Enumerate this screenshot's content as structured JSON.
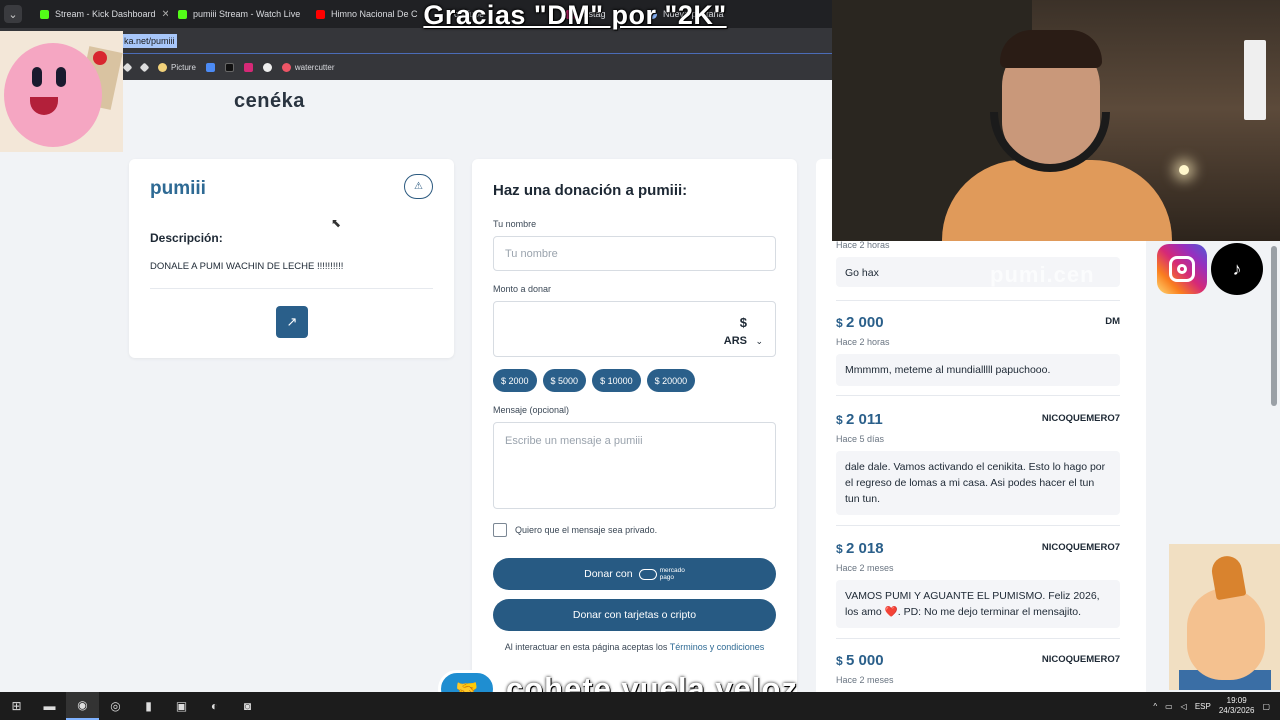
{
  "browser": {
    "tabs": [
      {
        "label": "Stream - Kick Dashboard",
        "color": "#53fc18"
      },
      {
        "label": "pumiii Stream - Watch Live",
        "color": "#53fc18"
      },
      {
        "label": "Himno Nacional De C",
        "color": "#ff0000"
      },
      {
        "label": "ouTube",
        "color": "#ff0000"
      },
      {
        "label": "Instag",
        "color": "#d62976"
      },
      {
        "label": "Nueva pestaña",
        "color": "#8ab4f8"
      }
    ],
    "address": "ka.net/pumiii",
    "bookmarks": [
      {
        "label": "",
        "icon": "bookmark-diamond-icon",
        "color": "#ddd"
      },
      {
        "label": "",
        "icon": "bookmark-diamond-icon",
        "color": "#ddd"
      },
      {
        "label": "Picture",
        "icon": "picture-icon",
        "color": "#f2d27a"
      },
      {
        "label": "",
        "icon": "bookmark-square-icon",
        "color": "#4c8bf5"
      },
      {
        "label": "",
        "icon": "tiktok-icon",
        "color": "#111"
      },
      {
        "label": "",
        "icon": "instagram-icon",
        "color": "#d62976"
      },
      {
        "label": "",
        "icon": "circle-icon",
        "color": "#eee"
      },
      {
        "label": "watercutter",
        "icon": "watercutter-icon",
        "color": "#e56"
      }
    ]
  },
  "overlay": {
    "title": "Gracias \"DM\" por \"2K\"",
    "ghost_text": "pumi.cen",
    "bottom_brand": "cohete.vuela.veloz"
  },
  "page": {
    "logo": "cenéka",
    "profile": {
      "name": "pumiii",
      "desc_title": "Descripción:",
      "desc_text": "DONALE A PUMI WACHIN DE LECHE !!!!!!!!!!"
    },
    "form": {
      "title": "Haz una donación a pumiii:",
      "name_label": "Tu nombre",
      "name_placeholder": "Tu nombre",
      "amount_label": "Monto a donar",
      "currency_symbol": "$",
      "currency_code": "ARS",
      "chips": [
        "$ 2000",
        "$ 5000",
        "$ 10000",
        "$ 20000"
      ],
      "message_label": "Mensaje (opcional)",
      "message_placeholder": "Escribe un mensaje a pumiii",
      "private_label": "Quiero que el mensaje sea privado.",
      "donate_mp_label": "Donar con",
      "mp_line1": "mercado",
      "mp_line2": "pago",
      "donate_card_label": "Donar con tarjetas o cripto",
      "terms_prefix": "Al interactuar en esta página aceptas los ",
      "terms_link": "Términos y condiciones"
    },
    "donations": [
      {
        "amount": "",
        "name": "",
        "time": "Hace 2 horas",
        "message": "Go hax"
      },
      {
        "amount": "2 000",
        "name": "DM",
        "time": "Hace 2 horas",
        "message": "Mmmmm, meteme al mundialllll papuchooo."
      },
      {
        "amount": "2 011",
        "name": "NICOQUEMERO7",
        "time": "Hace 5 días",
        "message": "dale dale. Vamos activando el cenikita. Esto lo hago por el regreso de lomas a mi casa. Asi podes hacer el tun tun tun."
      },
      {
        "amount": "2 018",
        "name": "NICOQUEMERO7",
        "time": "Hace 2 meses",
        "message": "VAMOS PUMI Y AGUANTE EL PUMISMO. Feliz 2026, los amo ❤️. PD: No me dejo terminar el mensajito."
      },
      {
        "amount": "5 000",
        "name": "NICOQUEMERO7",
        "time": "Hace 2 meses",
        "message": ""
      }
    ]
  },
  "taskbar": {
    "lang": "ESP",
    "time": "19:09",
    "date": "24/3/2026"
  }
}
